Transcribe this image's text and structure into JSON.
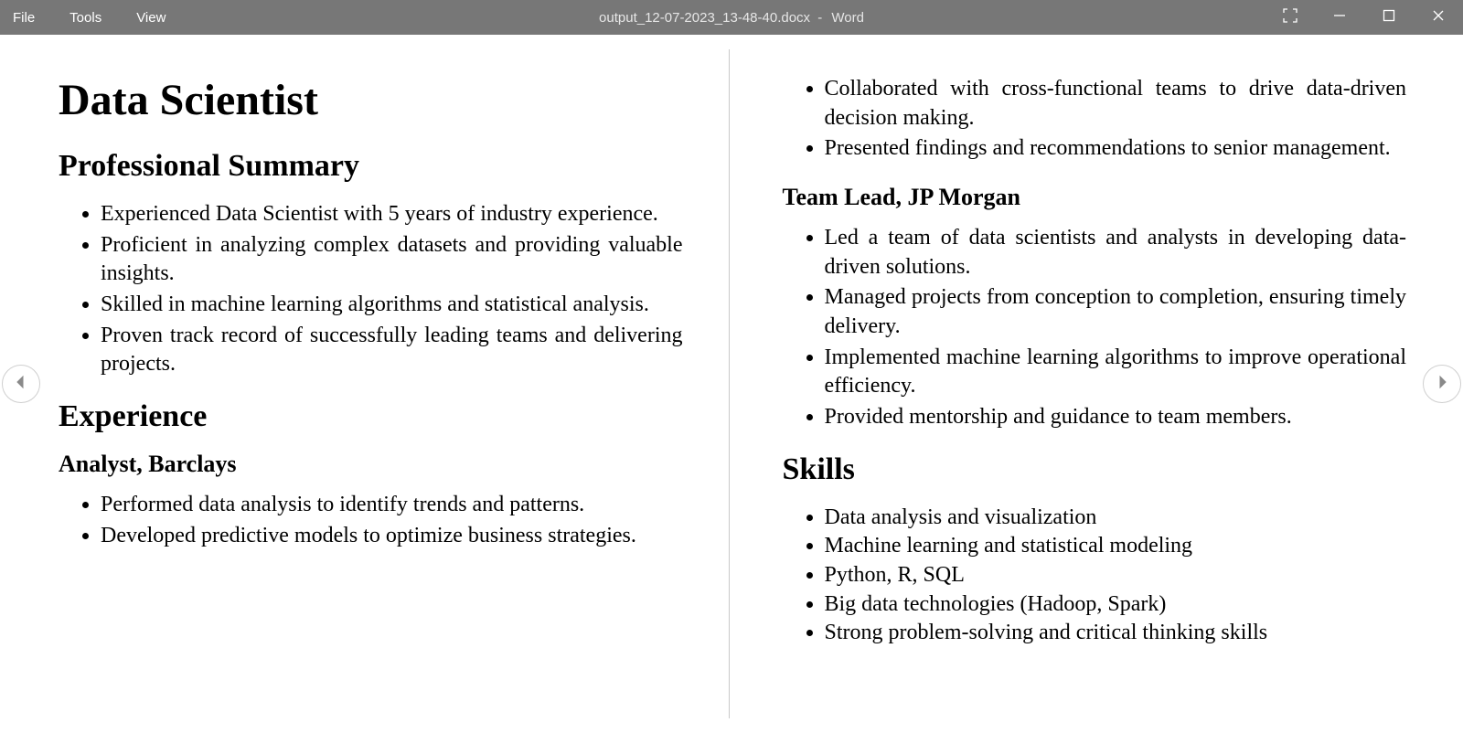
{
  "titlebar": {
    "menus": [
      "File",
      "Tools",
      "View"
    ],
    "filename": "output_12-07-2023_13-48-40.docx",
    "app": "Word"
  },
  "document": {
    "title": "Data Scientist",
    "sections": {
      "summary": {
        "heading": "Professional Summary",
        "bullets": [
          "Experienced Data Scientist with 5 years of industry experience.",
          "Proficient in analyzing complex datasets and providing valuable insights.",
          "Skilled in machine learning algorithms and statistical analysis.",
          "Proven track record of successfully leading teams and delivering projects."
        ]
      },
      "experience": {
        "heading": "Experience",
        "jobs": [
          {
            "title": "Analyst, Barclays",
            "bullets": [
              "Performed data analysis to identify trends and patterns.",
              "Developed predictive models to optimize business strategies.",
              "Collaborated with cross-functional teams to drive data-driven decision making.",
              "Presented findings and recommendations to senior management."
            ]
          },
          {
            "title": "Team Lead, JP Morgan",
            "bullets": [
              "Led a team of data scientists and analysts in developing data-driven solutions.",
              "Managed projects from conception to completion, ensuring timely delivery.",
              "Implemented machine learning algorithms to improve operational efficiency.",
              "Provided mentorship and guidance to team members."
            ]
          }
        ]
      },
      "skills": {
        "heading": "Skills",
        "bullets": [
          "Data analysis and visualization",
          "Machine learning and statistical modeling",
          "Python, R, SQL",
          "Big data technologies (Hadoop, Spark)",
          "Strong problem-solving and critical thinking skills"
        ]
      }
    }
  }
}
